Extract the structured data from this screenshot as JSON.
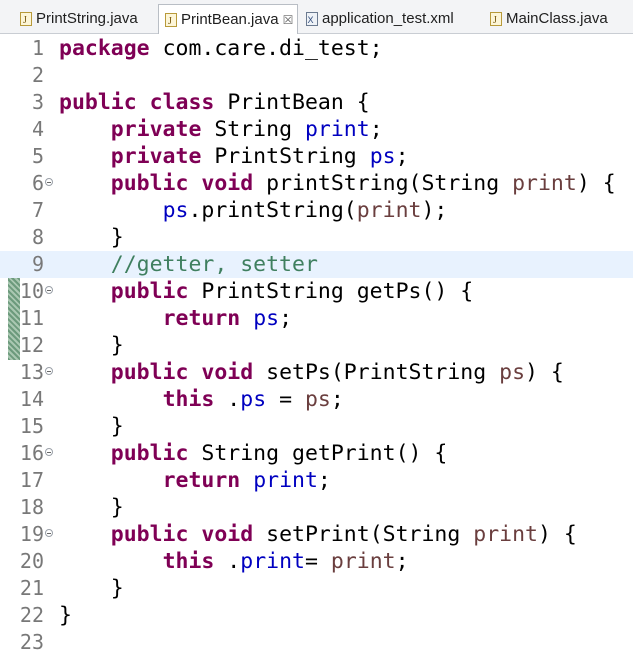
{
  "tabs": [
    {
      "label": "PrintString.java",
      "icon": "java-file-icon",
      "active": false
    },
    {
      "label": "PrintBean.java",
      "icon": "java-file-icon",
      "active": true,
      "close": "☒"
    },
    {
      "label": "application_test.xml",
      "icon": "xml-file-icon",
      "active": false
    },
    {
      "label": "MainClass.java",
      "icon": "java-file-icon",
      "active": false
    }
  ],
  "colors": {
    "keyword": "#7f0055",
    "field": "#0000c0",
    "param": "#6a3e3e",
    "comment": "#3f7f5f",
    "highlight": "#e8f2fe"
  },
  "lines": [
    {
      "n": "1",
      "tokens": [
        [
          "kw",
          "package"
        ],
        [
          "",
          "com.care.di_test;"
        ]
      ]
    },
    {
      "n": "2",
      "tokens": []
    },
    {
      "n": "3",
      "tokens": [
        [
          "kw",
          "public"
        ],
        [
          "",
          ""
        ],
        [
          "kw",
          "class"
        ],
        [
          "",
          "PrintBean {"
        ]
      ]
    },
    {
      "n": "4",
      "tokens": [
        [
          "",
          "    "
        ],
        [
          "kw",
          "private"
        ],
        [
          "",
          "String "
        ],
        [
          "fld",
          "print"
        ],
        [
          "",
          ";"
        ]
      ]
    },
    {
      "n": "5",
      "tokens": [
        [
          "",
          "    "
        ],
        [
          "kw",
          "private"
        ],
        [
          "",
          "PrintString "
        ],
        [
          "fld",
          "ps"
        ],
        [
          "",
          ";"
        ]
      ]
    },
    {
      "n": "6",
      "fold": true,
      "tokens": [
        [
          "",
          "    "
        ],
        [
          "kw",
          "public"
        ],
        [
          "",
          ""
        ],
        [
          "kw",
          "void"
        ],
        [
          "",
          "printString(String "
        ],
        [
          "prm",
          "print"
        ],
        [
          "",
          ") {"
        ]
      ]
    },
    {
      "n": "7",
      "tokens": [
        [
          "",
          "        "
        ],
        [
          "fld",
          "ps"
        ],
        [
          "",
          ".printString("
        ],
        [
          "prm",
          "print"
        ],
        [
          "",
          ");"
        ]
      ]
    },
    {
      "n": "8",
      "tokens": [
        [
          "",
          "    }"
        ]
      ]
    },
    {
      "n": "9",
      "highlight": true,
      "tokens": [
        [
          "",
          "    "
        ],
        [
          "cmt",
          "//getter, setter"
        ]
      ]
    },
    {
      "n": "10",
      "fold": true,
      "tokens": [
        [
          "",
          "    "
        ],
        [
          "kw",
          "public"
        ],
        [
          "",
          "PrintString getPs() {"
        ]
      ]
    },
    {
      "n": "11",
      "tokens": [
        [
          "",
          "        "
        ],
        [
          "kw",
          "return"
        ],
        [
          "",
          ""
        ],
        [
          "fld",
          "ps"
        ],
        [
          "",
          ";"
        ]
      ]
    },
    {
      "n": "12",
      "tokens": [
        [
          "",
          "    }"
        ]
      ]
    },
    {
      "n": "13",
      "fold": true,
      "tokens": [
        [
          "",
          "    "
        ],
        [
          "kw",
          "public"
        ],
        [
          "",
          ""
        ],
        [
          "kw",
          "void"
        ],
        [
          "",
          "setPs(PrintString "
        ],
        [
          "prm",
          "ps"
        ],
        [
          "",
          ") {"
        ]
      ]
    },
    {
      "n": "14",
      "tokens": [
        [
          "",
          "        "
        ],
        [
          "kw",
          "this"
        ],
        [
          "",
          "."
        ],
        [
          "fld",
          "ps"
        ],
        [
          "",
          " = "
        ],
        [
          "prm",
          "ps"
        ],
        [
          "",
          ";"
        ]
      ]
    },
    {
      "n": "15",
      "tokens": [
        [
          "",
          "    }"
        ]
      ]
    },
    {
      "n": "16",
      "fold": true,
      "tokens": [
        [
          "",
          "    "
        ],
        [
          "kw",
          "public"
        ],
        [
          "",
          "String getPrint() {"
        ]
      ]
    },
    {
      "n": "17",
      "tokens": [
        [
          "",
          "        "
        ],
        [
          "kw",
          "return"
        ],
        [
          "",
          ""
        ],
        [
          "fld",
          "print"
        ],
        [
          "",
          ";"
        ]
      ]
    },
    {
      "n": "18",
      "tokens": [
        [
          "",
          "    }"
        ]
      ]
    },
    {
      "n": "19",
      "fold": true,
      "tokens": [
        [
          "",
          "    "
        ],
        [
          "kw",
          "public"
        ],
        [
          "",
          ""
        ],
        [
          "kw",
          "void"
        ],
        [
          "",
          "setPrint(String "
        ],
        [
          "prm",
          "print"
        ],
        [
          "",
          ") {"
        ]
      ]
    },
    {
      "n": "20",
      "tokens": [
        [
          "",
          "        "
        ],
        [
          "kw",
          "this"
        ],
        [
          "",
          "."
        ],
        [
          "fld",
          "print"
        ],
        [
          "",
          ""
        ],
        [
          "",
          "= "
        ],
        [
          "prm",
          "print"
        ],
        [
          "",
          ";"
        ]
      ]
    },
    {
      "n": "21",
      "tokens": [
        [
          "",
          "    }"
        ]
      ]
    },
    {
      "n": "22",
      "tokens": [
        [
          "",
          "}"
        ]
      ]
    },
    {
      "n": "23",
      "tokens": []
    }
  ]
}
